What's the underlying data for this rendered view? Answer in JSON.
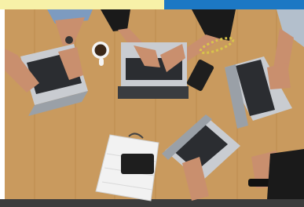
{
  "image": {
    "subject": "overhead-laptops-on-table",
    "colors": {
      "table": "#c99a5e",
      "table_dark": "#b8854a",
      "top_band": "#f7f1a8",
      "accent_bar": "#1c78c4",
      "laptop_body": "#c9ccd1",
      "laptop_keys": "#2b2d31",
      "skin": "#c98f6e",
      "sleeve_dark": "#1a1a1a",
      "sleeve_blue": "#7d9bc0",
      "notebook": "#f2f2f2",
      "phone": "#1e1e1e",
      "mug": "#f4f4f4",
      "coffee": "#3a2718",
      "floor": "#3c3c3c"
    }
  }
}
